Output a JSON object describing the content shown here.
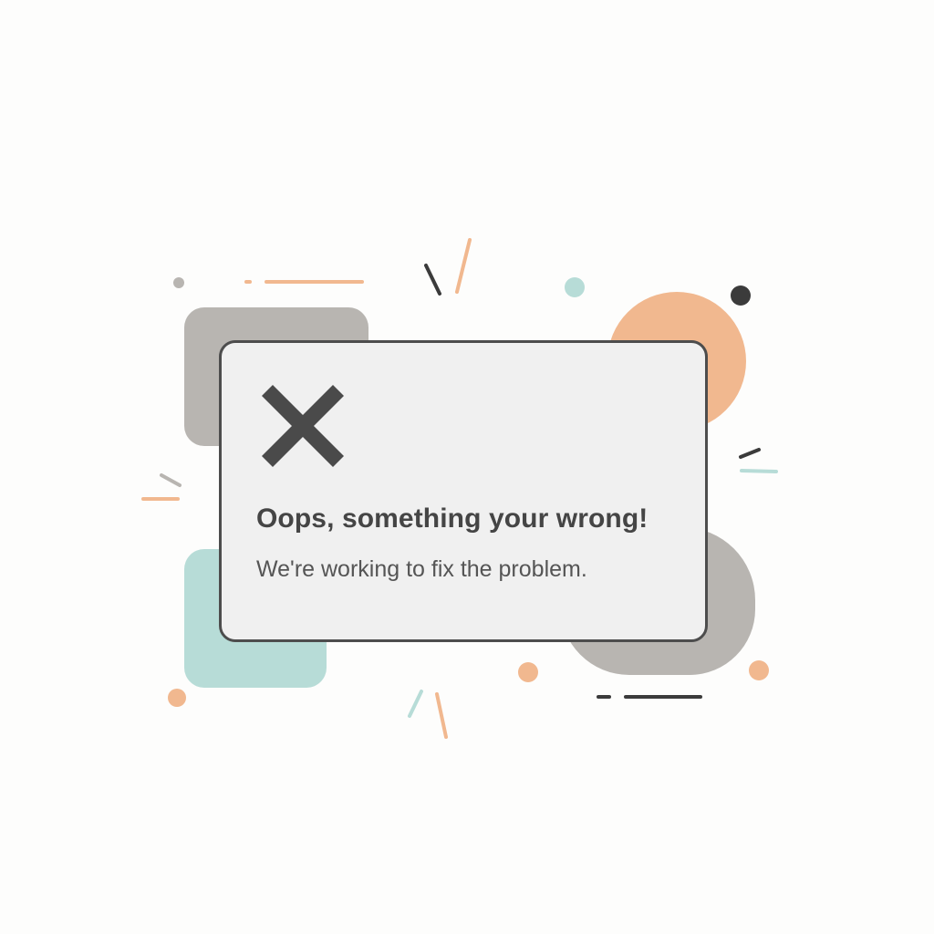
{
  "error_dialog": {
    "icon": "close-x-icon",
    "title": "Oops, something your wrong!",
    "message": "We're working to fix the problem."
  },
  "colors": {
    "accent_orange": "#f1b88f",
    "accent_teal": "#b7dcd7",
    "accent_gray": "#b8b5b1",
    "dark": "#4d4d4d",
    "card_background": "#f0f0f0"
  }
}
